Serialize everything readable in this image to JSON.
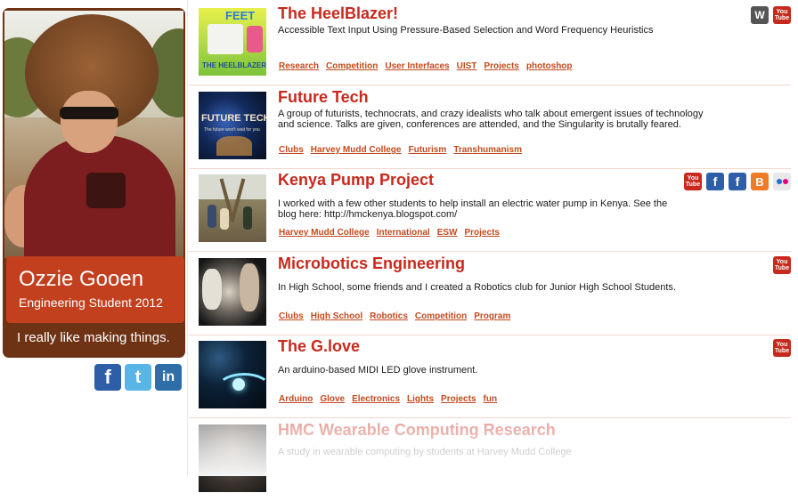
{
  "profile": {
    "name": "Ozzie Gooen",
    "role": "Engineering Student 2012",
    "tagline": "I really like making things.",
    "social": [
      {
        "icon": "facebook-icon",
        "glyph": "f"
      },
      {
        "icon": "twitter-icon",
        "glyph": "t"
      },
      {
        "icon": "linkedin-icon",
        "glyph": "in"
      }
    ]
  },
  "colors": {
    "accent": "#c8291d",
    "tag": "#c24a1e",
    "card": "#6e3314",
    "plate": "#c2401e"
  },
  "projects": [
    {
      "title": "The HeelBlazer!",
      "description": "Accessible Text Input Using Pressure-Based Selection and Word Frequency Heuristics",
      "thumb_text_top": "FEET",
      "thumb_text_bottom": "THE HEELBLAZER",
      "tags": [
        "Research",
        "Competition",
        "User Interfaces",
        "UIST",
        "Projects",
        "photoshop"
      ],
      "icons": [
        "wordpress-icon",
        "youtube-icon"
      ]
    },
    {
      "title": "Future Tech",
      "description": "A group of futurists, technocrats, and crazy idealists who talk about emergent issues of technology and science. Talks are given, conferences are attended, and the Singularity is brutally feared.",
      "thumb_text_top": "FUTURE TECH",
      "thumb_text_bottom": "The future won't wait for you",
      "tags": [
        "Clubs",
        "Harvey Mudd College",
        "Futurism",
        "Transhumanism"
      ],
      "icons": []
    },
    {
      "title": "Kenya Pump Project",
      "description": "I worked with a few other students to help install an electric water pump in Kenya. See the blog here: http://hmckenya.blogspot.com/",
      "tags": [
        "Harvey Mudd College",
        "International",
        "ESW",
        "Projects"
      ],
      "icons": [
        "youtube-icon",
        "facebook-icon",
        "facebook-icon",
        "blogger-icon",
        "flickr-icon"
      ]
    },
    {
      "title": "Microbotics Engineering",
      "description": "In High School, some friends and I created a Robotics club for Junior High School Students.",
      "tags": [
        "Clubs",
        "High School",
        "Robotics",
        "Competition",
        "Program"
      ],
      "icons": [
        "youtube-icon"
      ]
    },
    {
      "title": "The G.love",
      "description": "An arduino-based MIDI LED glove instrument.",
      "tags": [
        "Arduino",
        "Glove",
        "Electronics",
        "Lights",
        "Projects",
        "fun"
      ],
      "icons": [
        "youtube-icon"
      ]
    },
    {
      "title": "HMC Wearable Computing Research",
      "description": "A study in wearable computing by students at Harvey Mudd College",
      "tags": [],
      "icons": []
    }
  ],
  "icon_glyphs": {
    "youtube": [
      "You",
      "Tube"
    ],
    "wordpress": "W",
    "facebook": "f",
    "blogger": "B"
  }
}
